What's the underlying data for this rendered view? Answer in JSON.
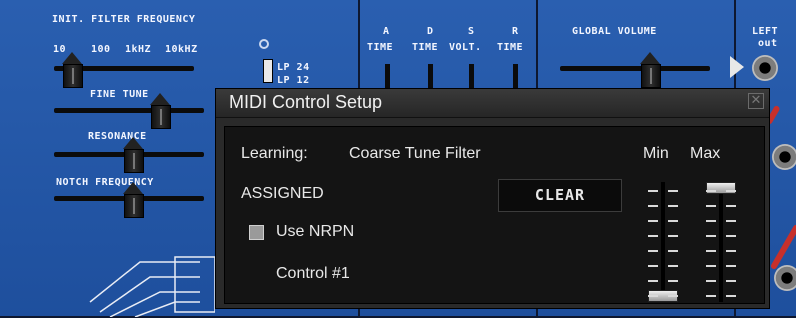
{
  "rack": {
    "filter_title": "INIT. FILTER FREQUENCY",
    "freq_scale": [
      "10",
      "100",
      "1kHZ",
      "10kHZ"
    ],
    "fine_tune": "FINE TUNE",
    "resonance": "RESONANCE",
    "notch_frequency": "NOTCH FREQUENCY",
    "lp24": "LP 24",
    "lp12": "LP 12",
    "env_letters": [
      "A",
      "D",
      "S",
      "R"
    ],
    "env_params": [
      "TIME",
      "TIME",
      "VOLT.",
      "TIME"
    ],
    "global_volume": "GLOBAL VOLUME",
    "left_out": [
      "LEFT",
      "out"
    ]
  },
  "dialog": {
    "title": "MIDI Control Setup",
    "close_glyph": "✕",
    "learning_label": "Learning:",
    "learning_target": "Coarse Tune Filter",
    "status": "ASSIGNED",
    "clear_label": "CLEAR",
    "use_nrpn_label": "Use NRPN",
    "use_nrpn_checked": false,
    "control_label": "Control #1",
    "min_label": "Min",
    "max_label": "Max",
    "min_value_fraction": 0.0,
    "max_value_fraction": 1.0
  },
  "colors": {
    "panel_blue": "#1e4f9d",
    "dialog_bg": "#2a2a2a",
    "cable_red": "#c7302b"
  }
}
